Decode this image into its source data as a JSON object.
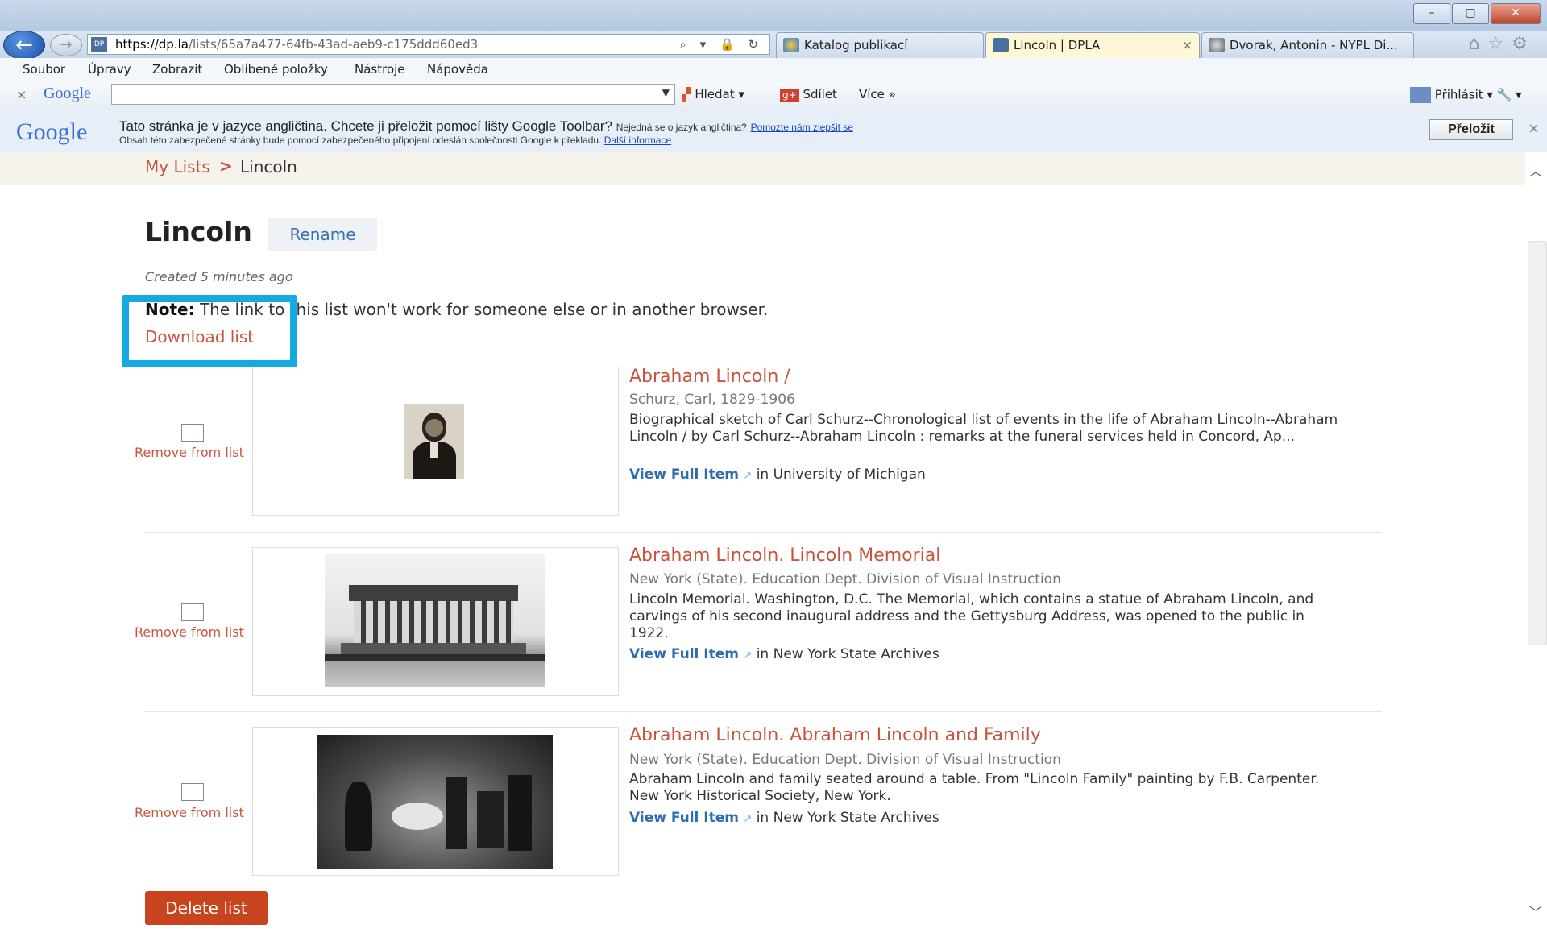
{
  "browser": {
    "url_host": "https://dp.la",
    "url_path": "/lists/65a7a477-64fb-43ad-aeb9-c175ddd60ed3",
    "url_tools": "⌕ ▾ 🔒 ↻",
    "tabs": [
      {
        "label": "Katalog publikací",
        "active": false
      },
      {
        "label": "Lincoln | DPLA",
        "active": true
      },
      {
        "label": "Dvorak, Antonin - NYPL Di...",
        "active": false
      }
    ],
    "tab_close": "×",
    "window_buttons": {
      "minimize": "–",
      "maximize": "▢",
      "close": "✕"
    }
  },
  "menu": [
    "Soubor",
    "Úpravy",
    "Zobrazit",
    "Oblíbené položky",
    "Nástroje",
    "Nápověda"
  ],
  "google_toolbar": {
    "close": "×",
    "logo": "Google",
    "search_value": "",
    "search_label": "Hledat",
    "share_label": "Sdílet",
    "more_label": "Více »",
    "signin_label": "Přihlásit"
  },
  "translate_bar": {
    "logo": "Google",
    "message": "Tato stránka je v jazyce angličtina. Chcete ji přeložit pomocí lišty Google Toolbar?",
    "not_english": "Nejedná se o jazyk angličtina?",
    "help_link": "Pomozte nám zlepšit se",
    "sub": "Obsah této zabezpečené stránky bude pomocí zabezpečeného připojení odeslán společnosti Google k překladu.",
    "more_info": "Další informace",
    "translate_button": "Přeložit",
    "close": "×"
  },
  "breadcrumb": {
    "first": "My Lists",
    "separator": ">",
    "current": "Lincoln"
  },
  "list": {
    "title": "Lincoln",
    "rename_label": "Rename",
    "created": "Created 5 minutes ago",
    "note_label": "Note:",
    "note_text": " The link to this list won't work for someone else or in another browser.",
    "download_label": "Download list",
    "delete_label": "Delete list"
  },
  "items": [
    {
      "title": "Abraham Lincoln /",
      "creator": "Schurz, Carl, 1829-1906",
      "description": "Biographical sketch of Carl Schurz--Chronological list of events in the life of Abraham Lincoln--Abraham Lincoln / by Carl Schurz--Abraham Lincoln : remarks at the funeral services held in Concord, Ap...",
      "view_label": "View Full Item",
      "in_text": "in University of Michigan",
      "remove_label": "Remove from list"
    },
    {
      "title": "Abraham Lincoln. Lincoln Memorial",
      "creator": "New York (State). Education Dept. Division of Visual Instruction",
      "description": "Lincoln Memorial. Washington, D.C. The Memorial, which contains a statue of Abraham Lincoln, and carvings of his second inaugural address and the Gettysburg Address, was opened to the public in 1922.",
      "view_label": "View Full Item",
      "in_text": "in New York State Archives",
      "remove_label": "Remove from list"
    },
    {
      "title": "Abraham Lincoln. Abraham Lincoln and Family",
      "creator": "New York (State). Education Dept. Division of Visual Instruction",
      "description": "Abraham Lincoln and family seated around a table. From \"Lincoln Family\" painting by F.B. Carpenter. New York Historical Society, New York.",
      "view_label": "View Full Item",
      "in_text": "in New York State Archives",
      "remove_label": "Remove from list"
    }
  ],
  "colors": {
    "accent": "#c8553b",
    "highlight": "#14a9e1",
    "link": "#2d6cb0",
    "delete": "#c8441f"
  }
}
